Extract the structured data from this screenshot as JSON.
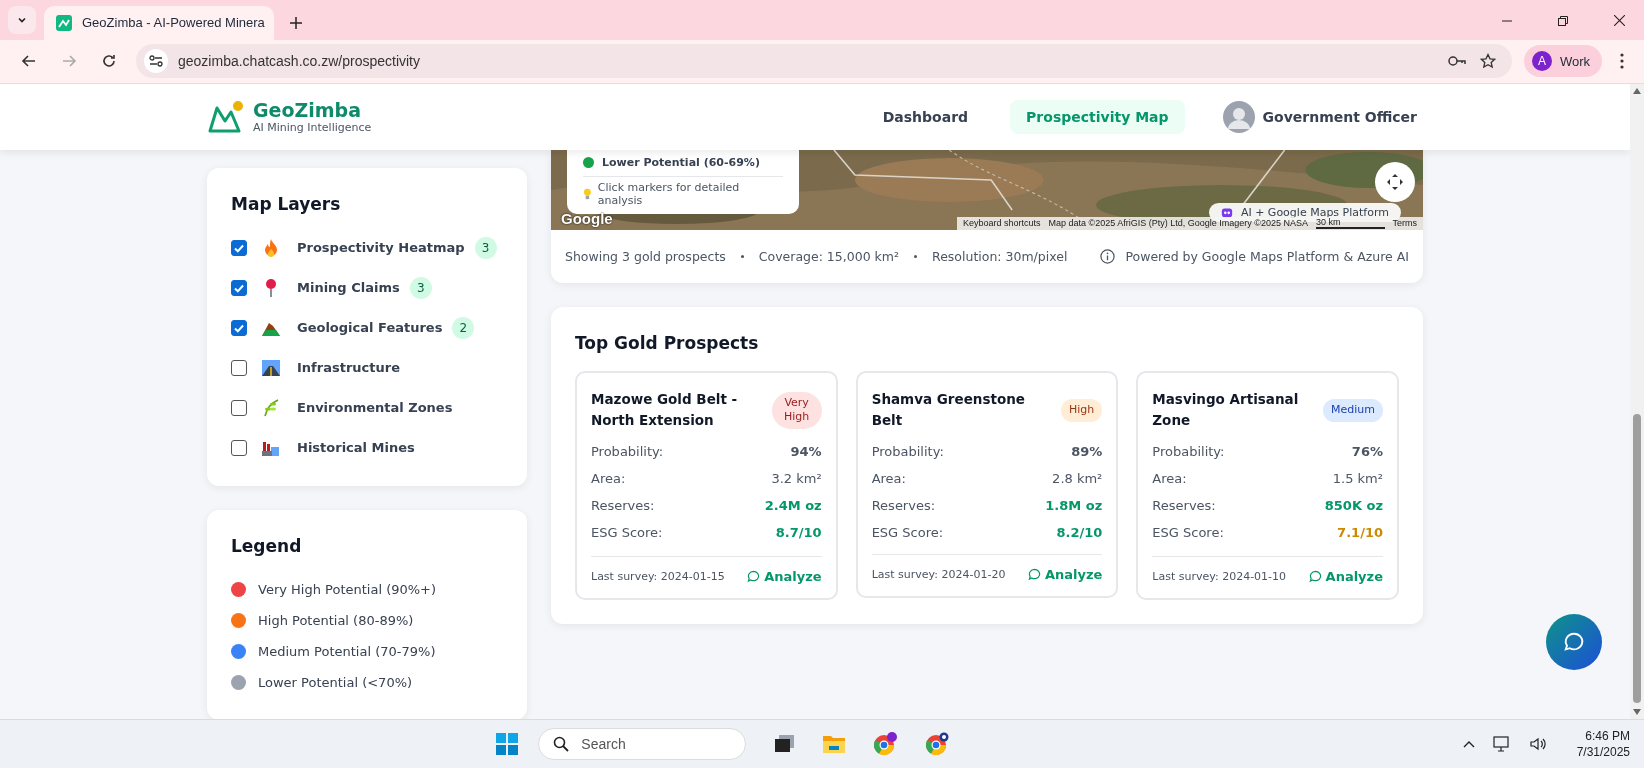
{
  "browser": {
    "tab_title": "GeoZimba - AI-Powered Minera",
    "url": "geozimba.chatcash.co.zw/prospectivity",
    "profile_initial": "A",
    "profile_name": "Work"
  },
  "header": {
    "brand": "GeoZimba",
    "tagline": "AI Mining Intelligence",
    "nav": [
      {
        "label": "Dashboard",
        "selected": false
      },
      {
        "label": "Prospectivity Map",
        "selected": true
      }
    ],
    "user": "Government Officer"
  },
  "layers": {
    "title": "Map Layers",
    "items": [
      {
        "label": "Prospectivity Heatmap",
        "checked": true,
        "count": "3"
      },
      {
        "label": "Mining Claims",
        "checked": true,
        "count": "3"
      },
      {
        "label": "Geological Features",
        "checked": true,
        "count": "2"
      },
      {
        "label": "Infrastructure",
        "checked": false
      },
      {
        "label": "Environmental Zones",
        "checked": false
      },
      {
        "label": "Historical Mines",
        "checked": false
      }
    ]
  },
  "legend": {
    "title": "Legend",
    "items": [
      {
        "label": "Very High Potential (90%+)",
        "color": "#ef4444"
      },
      {
        "label": "High Potential (80-89%)",
        "color": "#f97316"
      },
      {
        "label": "Medium Potential (70-79%)",
        "color": "#3b82f6"
      },
      {
        "label": "Lower Potential (<70%)",
        "color": "#9ca3af"
      }
    ]
  },
  "map": {
    "overlay_legend": {
      "label": "Lower Potential (60-69%)",
      "color": "#16a34a"
    },
    "hint": "Click markers for detailed analysis",
    "logo": "Google",
    "badge": "AI + Google Maps Platform",
    "attribution": [
      "Keyboard shortcuts",
      "Map data ©2025 AfriGIS (Pty) Ltd, Google Imagery ©2025 NASA",
      "30 km",
      "Terms"
    ]
  },
  "stats": {
    "items": [
      "Showing 3 gold prospects",
      "Coverage: 15,000 km²",
      "Resolution: 30m/pixel"
    ],
    "powered": "Powered by Google Maps Platform & Azure AI"
  },
  "prospects": {
    "title": "Top Gold Prospects",
    "cards": [
      {
        "name": "Mazowe Gold Belt - North Extension",
        "badge": "Very High",
        "kind": "very_high",
        "rows": [
          {
            "label": "Probability:",
            "value": "94%",
            "kind": "strong"
          },
          {
            "label": "Area:",
            "value": "3.2 km²",
            "kind": "plain"
          },
          {
            "label": "Reserves:",
            "value": "2.4M oz",
            "kind": "good"
          },
          {
            "label": "ESG Score:",
            "value": "8.7/10",
            "kind": "good"
          }
        ],
        "survey": "Last survey: 2024-01-15",
        "action": "Analyze"
      },
      {
        "name": "Shamva Greenstone Belt",
        "badge": "High",
        "kind": "high",
        "rows": [
          {
            "label": "Probability:",
            "value": "89%",
            "kind": "strong"
          },
          {
            "label": "Area:",
            "value": "2.8 km²",
            "kind": "plain"
          },
          {
            "label": "Reserves:",
            "value": "1.8M oz",
            "kind": "good"
          },
          {
            "label": "ESG Score:",
            "value": "8.2/10",
            "kind": "good"
          }
        ],
        "survey": "Last survey: 2024-01-20",
        "action": "Analyze"
      },
      {
        "name": "Masvingo Artisanal Zone",
        "badge": "Medium",
        "kind": "medium",
        "rows": [
          {
            "label": "Probability:",
            "value": "76%",
            "kind": "strong"
          },
          {
            "label": "Area:",
            "value": "1.5 km²",
            "kind": "plain"
          },
          {
            "label": "Reserves:",
            "value": "850K oz",
            "kind": "good"
          },
          {
            "label": "ESG Score:",
            "value": "7.1/10",
            "kind": "warn"
          }
        ],
        "survey": "Last survey: 2024-01-10",
        "action": "Analyze"
      }
    ]
  },
  "taskbar": {
    "search_placeholder": "Search",
    "time": "6:46 PM",
    "date": "7/31/2025"
  }
}
